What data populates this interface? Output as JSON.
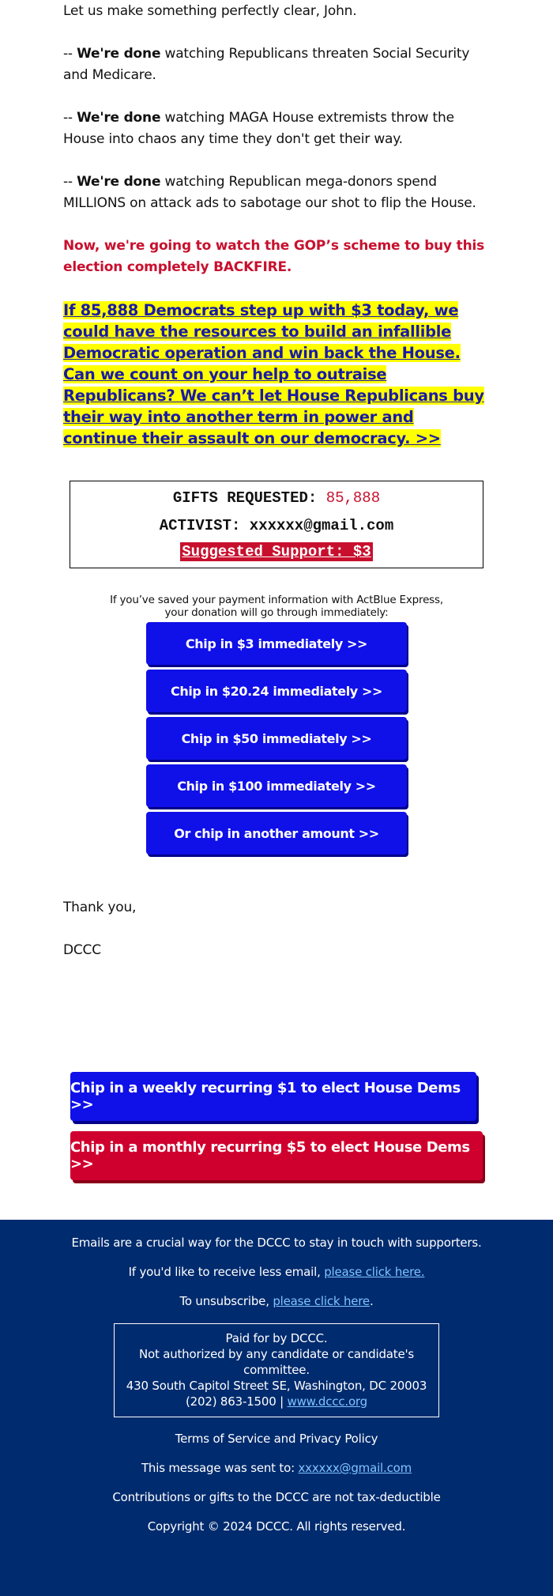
{
  "intro": "Let us make something perfectly clear, John.",
  "done_points": [
    {
      "lead": "-- ",
      "bold": "We're done",
      "rest": " watching Republicans threaten Social Security and Medicare."
    },
    {
      "lead": "-- ",
      "bold": "We're done",
      "rest": " watching MAGA House extremists throw the House into chaos any time they don't get their way."
    },
    {
      "lead": "-- ",
      "bold": "We're done",
      "rest": " watching Republican mega-donors spend MILLIONS on attack ads to sabotage our shot to flip the House."
    }
  ],
  "red_headline": "Now, we're going to watch the GOP’s scheme to buy this election completely BACKFIRE.",
  "highlight_link": "If 85,888 Democrats step up with $3 today, we could have the resources to build an infallible Democratic operation and win back the House. Can we count on your help to outraise Republicans? We can’t let House Republicans buy their way into another term in power and continue their assault on our democracy. >>",
  "gift_box": {
    "gifts_label": "GIFTS REQUESTED: ",
    "gifts_value": "85,888",
    "activist_label": "ACTIVIST: ",
    "activist_value": "xxxxxx@gmail.com",
    "suggested": "Suggested Support: $3"
  },
  "express_note_line1": "If you’ve saved your payment information with ActBlue Express,",
  "express_note_line2": "your donation will go through immediately:",
  "donate_buttons": [
    "Chip in $3 immediately >>",
    "Chip in $20.24 immediately >>",
    "Chip in $50 immediately >>",
    "Chip in $100 immediately >>",
    "Or chip in another amount >>"
  ],
  "thanks": "Thank you,",
  "signature": "DCCC",
  "recurring_buttons": {
    "weekly": "Chip in a weekly recurring $1 to elect House Dems >>",
    "monthly": "Chip in a monthly recurring $5 to elect House Dems >>"
  },
  "footer": {
    "line1": "Emails are a crucial way for the DCCC to stay in touch with supporters.",
    "less_email_text": "If you'd like to receive less email, ",
    "less_email_link": "please click here.",
    "unsub_text": "To unsubscribe, ",
    "unsub_link": "please click here",
    "unsub_tail": ".",
    "paid_for": "Paid for by DCCC.",
    "not_authorized": "Not authorized by any candidate or candidate's committee.",
    "address": "430 South Capitol Street SE, Washington, DC 20003",
    "phone": "(202) 863-1500 | ",
    "website": "www.dccc.org",
    "terms": "Terms of Service and Privacy Policy",
    "sent_to_text": "This message was sent to: ",
    "sent_to_email": "xxxxxx@gmail.com",
    "tax_note": "Contributions or gifts to the DCCC are not tax-deductible",
    "copyright": "Copyright © 2024 DCCC. All rights reserved."
  },
  "colors": {
    "accent_red": "#c8102e",
    "button_blue": "#1010e8",
    "button_red": "#d0002e",
    "footer_navy": "#002b6e",
    "highlight_yellow": "#ffff00",
    "link_blue": "#1a1aa6"
  }
}
